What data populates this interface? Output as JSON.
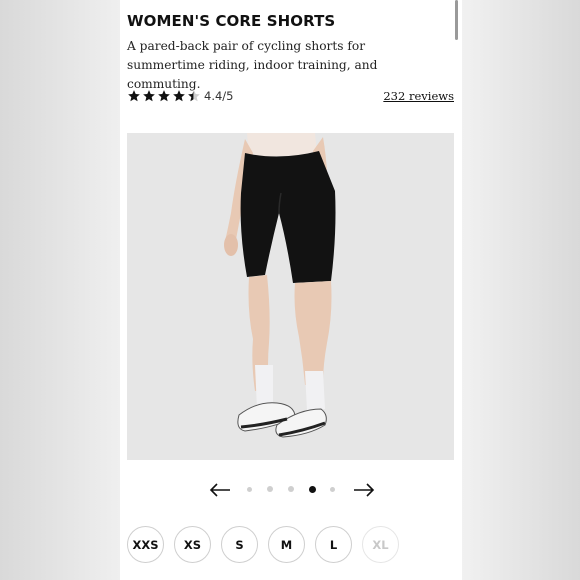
{
  "product": {
    "title": "WOMEN'S CORE SHORTS",
    "description": "A pared-back pair of cycling shorts for summertime riding, indoor training, and commuting.",
    "rating": {
      "value": 4.4,
      "label": "4.4/5",
      "stars_filled": 4,
      "stars_total": 5,
      "reviews_label": "232 reviews"
    },
    "image": {
      "description_icon": "product-photo-icon"
    }
  },
  "carousel": {
    "prev_icon": "arrow-left-icon",
    "next_icon": "arrow-right-icon",
    "slide_count": 5,
    "active_index": 3
  },
  "sizes": [
    {
      "label": "XXS",
      "available": true
    },
    {
      "label": "XS",
      "available": true
    },
    {
      "label": "S",
      "available": true
    },
    {
      "label": "M",
      "available": true
    },
    {
      "label": "L",
      "available": true
    },
    {
      "label": "XL",
      "available": false
    }
  ],
  "colors": {
    "text": "#111111",
    "page_bg": "#ffffff",
    "image_bg": "#e6e6e6",
    "dot_inactive": "#cfcfcf",
    "dot_active": "#111111",
    "disabled_text": "#c8c8c8"
  }
}
